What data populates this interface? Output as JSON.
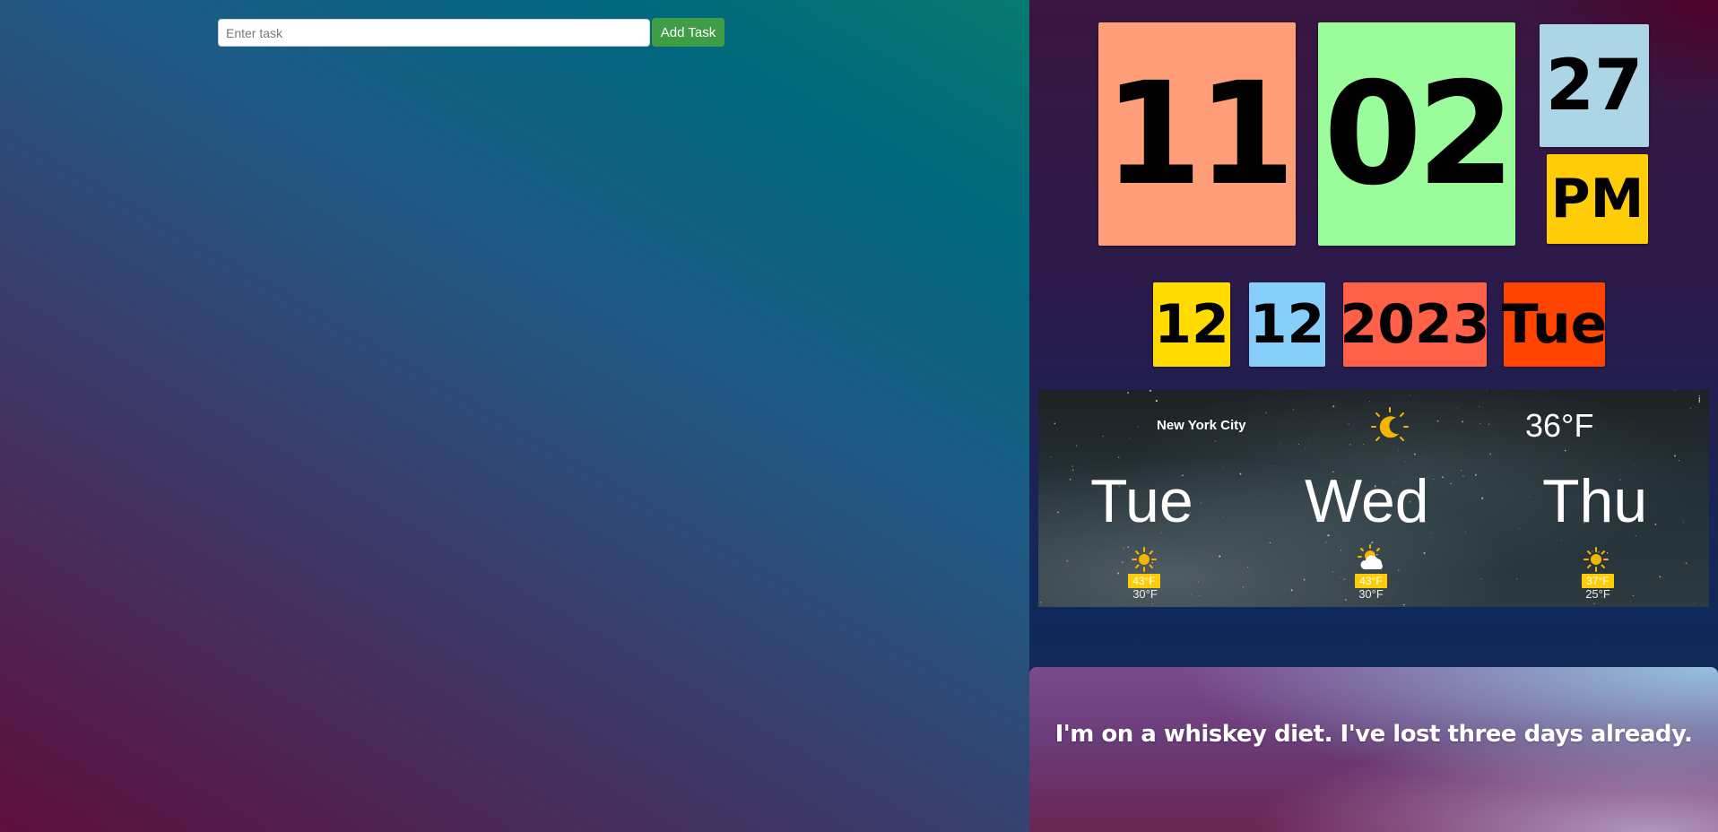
{
  "task": {
    "placeholder": "Enter task",
    "value": "",
    "add_label": "Add Task",
    "button_color": "#3f9e45"
  },
  "clock": {
    "hour": "11",
    "minute": "02",
    "second": "27",
    "ampm": "PM",
    "colors": {
      "hour": "#ff9e78",
      "minute": "#9afc9a",
      "second": "#acd6e5",
      "ampm": "#ffcd08"
    }
  },
  "date": {
    "month": "12",
    "day": "12",
    "year": "2023",
    "weekday": "Tue",
    "colors": {
      "month": "#ffdb00",
      "day": "#87cefa",
      "year": "#ff6148",
      "weekday": "#ff4400"
    }
  },
  "weather": {
    "city": "New York City",
    "current_icon": "moon-icon",
    "current_temp": "36°F",
    "info": "i",
    "forecast": [
      {
        "day": "Tue",
        "icon": "sun-icon",
        "high": "43°F",
        "low": "30°F"
      },
      {
        "day": "Wed",
        "icon": "partly-cloudy-icon",
        "high": "43°F",
        "low": "30°F"
      },
      {
        "day": "Thu",
        "icon": "sun-icon",
        "high": "37°F",
        "low": "25°F"
      }
    ]
  },
  "quote": {
    "text": "I'm on a whiskey diet. I've lost three days already."
  }
}
